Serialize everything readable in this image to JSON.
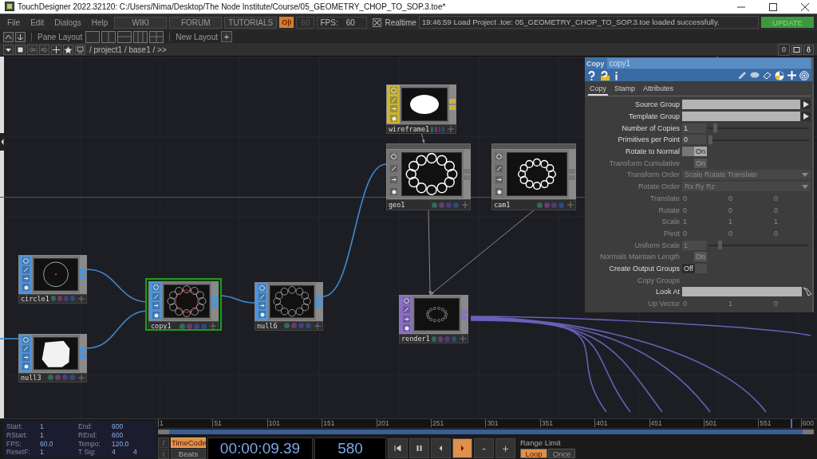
{
  "window": {
    "title": "TouchDesigner 2022.32120: C:/Users/Nima/Desktop/The Node Institute/Course/05_GEOMETRY_CHOP_TO_SOP.3.toe*"
  },
  "menu": [
    "File",
    "Edit",
    "Dialogs",
    "Help"
  ],
  "web_buttons": [
    "WIKI",
    "FORUM",
    "TUTORIALS"
  ],
  "perform_button": "O|I",
  "fps_cap": "60",
  "fps_label": "FPS:",
  "fps": "60",
  "realtime": {
    "label": "Realtime",
    "checked": true
  },
  "log": "19:46:59 Load Project .toe: 05_GEOMETRY_CHOP_TO_SOP.3.toe loaded successfully.",
  "update_button": "UPDATE",
  "layout_bar": {
    "pane_layout": "Pane Layout",
    "new_layout": "New Layout",
    "add": "+"
  },
  "path_bar": {
    "path": "/ project1 / base1 / >>",
    "count": "0"
  },
  "network": {
    "nodes": [
      {
        "name": "wireframe1",
        "kind": "mat",
        "selected": false
      },
      {
        "name": "geo1",
        "kind": "comp",
        "selected": false
      },
      {
        "name": "cam1",
        "kind": "comp",
        "selected": false
      },
      {
        "name": "circle1",
        "kind": "sop",
        "selected": false
      },
      {
        "name": "copy1",
        "kind": "sop",
        "selected": true
      },
      {
        "name": "null6",
        "kind": "sop",
        "selected": false
      },
      {
        "name": "null3",
        "kind": "sop",
        "selected": false
      },
      {
        "name": "render1",
        "kind": "top",
        "selected": false
      }
    ]
  },
  "parameters": {
    "type": "Copy",
    "name": "copy1",
    "tabs": [
      {
        "label": "Copy",
        "selected": true
      },
      {
        "label": "Stamp",
        "selected": false
      },
      {
        "label": "Attributes",
        "selected": false
      }
    ],
    "rows": [
      {
        "kind": "field",
        "label": "Source Group",
        "disabled": false
      },
      {
        "kind": "field",
        "label": "Template Group",
        "disabled": false
      },
      {
        "kind": "slider",
        "label": "Number of Copies",
        "value": "1",
        "level": 0.05,
        "disabled": false
      },
      {
        "kind": "slider",
        "label": "Primitives per Point",
        "value": "0",
        "level": 0,
        "disabled": false
      },
      {
        "kind": "toggle",
        "label": "Rotate to Normal",
        "value": "On",
        "on": true,
        "disabled": false
      },
      {
        "kind": "toggle",
        "label": "Transform Cumulative",
        "value": "On",
        "on": true,
        "disabled": true
      },
      {
        "kind": "menu",
        "label": "Transform Order",
        "value": "Scale Rotate Translate",
        "disabled": true
      },
      {
        "kind": "menu",
        "label": "Rotate Order",
        "value": "Rx Ry Rz",
        "disabled": true
      },
      {
        "kind": "xyz",
        "label": "Translate",
        "values": [
          "0",
          "0",
          "0"
        ],
        "disabled": true
      },
      {
        "kind": "xyz",
        "label": "Rotate",
        "values": [
          "0",
          "0",
          "0"
        ],
        "disabled": true
      },
      {
        "kind": "xyz",
        "label": "Scale",
        "values": [
          "1",
          "1",
          "1"
        ],
        "disabled": true
      },
      {
        "kind": "xyz",
        "label": "Pivot",
        "values": [
          "0",
          "0",
          "0"
        ],
        "disabled": true
      },
      {
        "kind": "slider",
        "label": "Uniform Scale",
        "value": "1",
        "level": 0.1,
        "disabled": true
      },
      {
        "kind": "toggle",
        "label": "Normals Maintain Length",
        "value": "On",
        "on": true,
        "disabled": true
      },
      {
        "kind": "toggle",
        "label": "Create Output Groups",
        "value": "Off",
        "on": false,
        "disabled": false
      },
      {
        "kind": "label",
        "label": "Copy Groups",
        "disabled": true
      },
      {
        "kind": "lookat",
        "label": "Look At",
        "disabled": false
      },
      {
        "kind": "xyz",
        "label": "Up Vector",
        "values": [
          "0",
          "1",
          "0"
        ],
        "disabled": true
      }
    ]
  },
  "timeline": {
    "info": [
      {
        "label": "Start:",
        "values": [
          "1"
        ]
      },
      {
        "label": "End:",
        "values": [
          "600"
        ]
      },
      {
        "label": "RStart:",
        "values": [
          "1"
        ]
      },
      {
        "label": "REnd:",
        "values": [
          "600"
        ]
      },
      {
        "label": "FPS:",
        "values": [
          "60.0"
        ]
      },
      {
        "label": "Tempo:",
        "values": [
          "120.0"
        ]
      },
      {
        "label": "ResetF:",
        "values": [
          "1"
        ]
      },
      {
        "label": "T Sig:",
        "values": [
          "4",
          "4"
        ]
      }
    ],
    "ruler": [
      "1",
      "51",
      "101",
      "151",
      "201",
      "251",
      "301",
      "351",
      "401",
      "451",
      "501",
      "551",
      "600"
    ],
    "playhead": {
      "level": 0.965
    },
    "mini_buttons": [
      "/",
      "I"
    ],
    "time_modes": [
      {
        "label": "TimeCode",
        "selected": true
      },
      {
        "label": "Beats",
        "selected": false
      }
    ],
    "timecode": "00:00:09.39",
    "frame": "580",
    "transport": [
      {
        "kind": "first",
        "selected": false
      },
      {
        "kind": "pause",
        "selected": false
      },
      {
        "kind": "back",
        "selected": false
      },
      {
        "kind": "play",
        "selected": true
      },
      {
        "kind": "text",
        "label": "-",
        "selected": false
      },
      {
        "kind": "text",
        "label": "+",
        "selected": false
      }
    ],
    "range_limit": {
      "label": "Range Limit",
      "options": [
        {
          "label": "Loop",
          "selected": true
        },
        {
          "label": "Once",
          "selected": false
        }
      ]
    }
  }
}
